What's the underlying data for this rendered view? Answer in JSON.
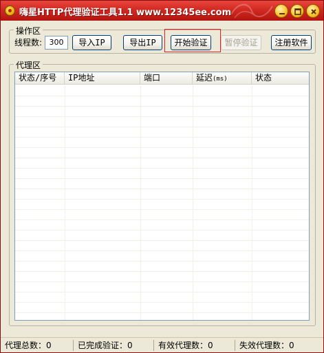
{
  "window": {
    "title": "嗨星HTTP代理验证工具1.1  www.12345ee.com"
  },
  "operations": {
    "group_title": "操作区",
    "threads_label": "线程数:",
    "threads_value": "300",
    "buttons": {
      "import_ip": "导入IP",
      "export_ip": "导出IP",
      "start_verify": "开始验证",
      "pause_verify": "暂停验证",
      "register": "注册软件"
    }
  },
  "proxy": {
    "group_title": "代理区",
    "columns": [
      "状态/序号",
      "IP地址",
      "端口",
      "延迟",
      "(ms)",
      "状态"
    ],
    "rows": []
  },
  "status": {
    "total": "代理总数：0",
    "done": "已完成验证：0",
    "valid": "有效代理数：0",
    "invalid": "失效代理数：0"
  },
  "colors": {
    "title_bar": "#d12a22",
    "highlight": "#e02020"
  }
}
